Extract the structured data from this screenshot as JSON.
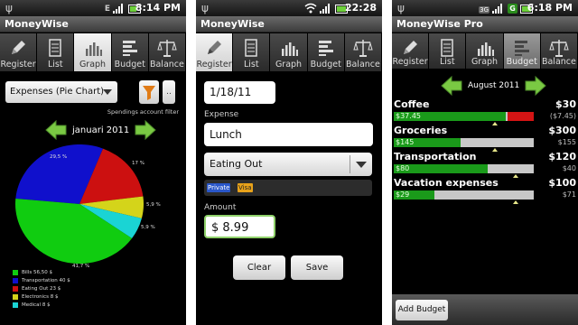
{
  "app_title": "MoneyWise",
  "app_title_pro": "MoneyWise Pro",
  "tabs": [
    "Register",
    "List",
    "Graph",
    "Budget",
    "Balance"
  ],
  "screen1": {
    "status": {
      "net_tag": "E",
      "time": "8:14 PM"
    },
    "report_select": "Expenses (Pie Chart)",
    "more_label": "..",
    "filter_label": "Spendings account filter",
    "month": "januari 2011",
    "pie_labels": {
      "transport": "29,5 %",
      "eating": "17 %",
      "elec": "5,9 %",
      "medical": "5,9 %",
      "bills": "41,7 %"
    },
    "legend": [
      {
        "label": "Bills  56,50 $",
        "color": "#10cc10"
      },
      {
        "label": "Transportation  40 $",
        "color": "#1010cc"
      },
      {
        "label": "Eating Out  23 $",
        "color": "#cc1010"
      },
      {
        "label": "Electronics  8 $",
        "color": "#d4d41a"
      },
      {
        "label": "Medical  8 $",
        "color": "#1ad4d4"
      }
    ],
    "pie_values": [
      56.5,
      40,
      23,
      8,
      8
    ]
  },
  "screen2": {
    "status": {
      "time": "22:28"
    },
    "date": "1/18/11",
    "expense_label": "Expense",
    "expense_value": "Lunch",
    "category": "Eating Out",
    "tags": [
      "Private",
      "Visa"
    ],
    "amount_label": "Amount",
    "amount_value": "$ 8.99",
    "clear_label": "Clear",
    "save_label": "Save"
  },
  "screen3": {
    "status": {
      "time": "6:18 PM"
    },
    "month": "August 2011",
    "budgets": [
      {
        "name": "Coffee",
        "amount": "$30",
        "spent": "$37.45",
        "remaining": "($7.45)",
        "progress": 1.25,
        "period_marker": 0.72
      },
      {
        "name": "Groceries",
        "amount": "$300",
        "spent": "$145",
        "remaining": "$155",
        "progress": 0.48,
        "period_marker": 0.72
      },
      {
        "name": "Transportation",
        "amount": "$120",
        "spent": "$80",
        "remaining": "$40",
        "progress": 0.67,
        "period_marker": 0.87
      },
      {
        "name": "Vacation expenses",
        "amount": "$100",
        "spent": "$29",
        "remaining": "$71",
        "progress": 0.29,
        "period_marker": 0.87
      }
    ],
    "add_label": "Add Budget"
  },
  "colors": {
    "bills": "#10cc10",
    "transport": "#1010cc",
    "eating": "#cc1010",
    "elec": "#d4d41a",
    "medical": "#1ad4d4",
    "budget_green": "#1a9a1a",
    "budget_red": "#d41414"
  }
}
